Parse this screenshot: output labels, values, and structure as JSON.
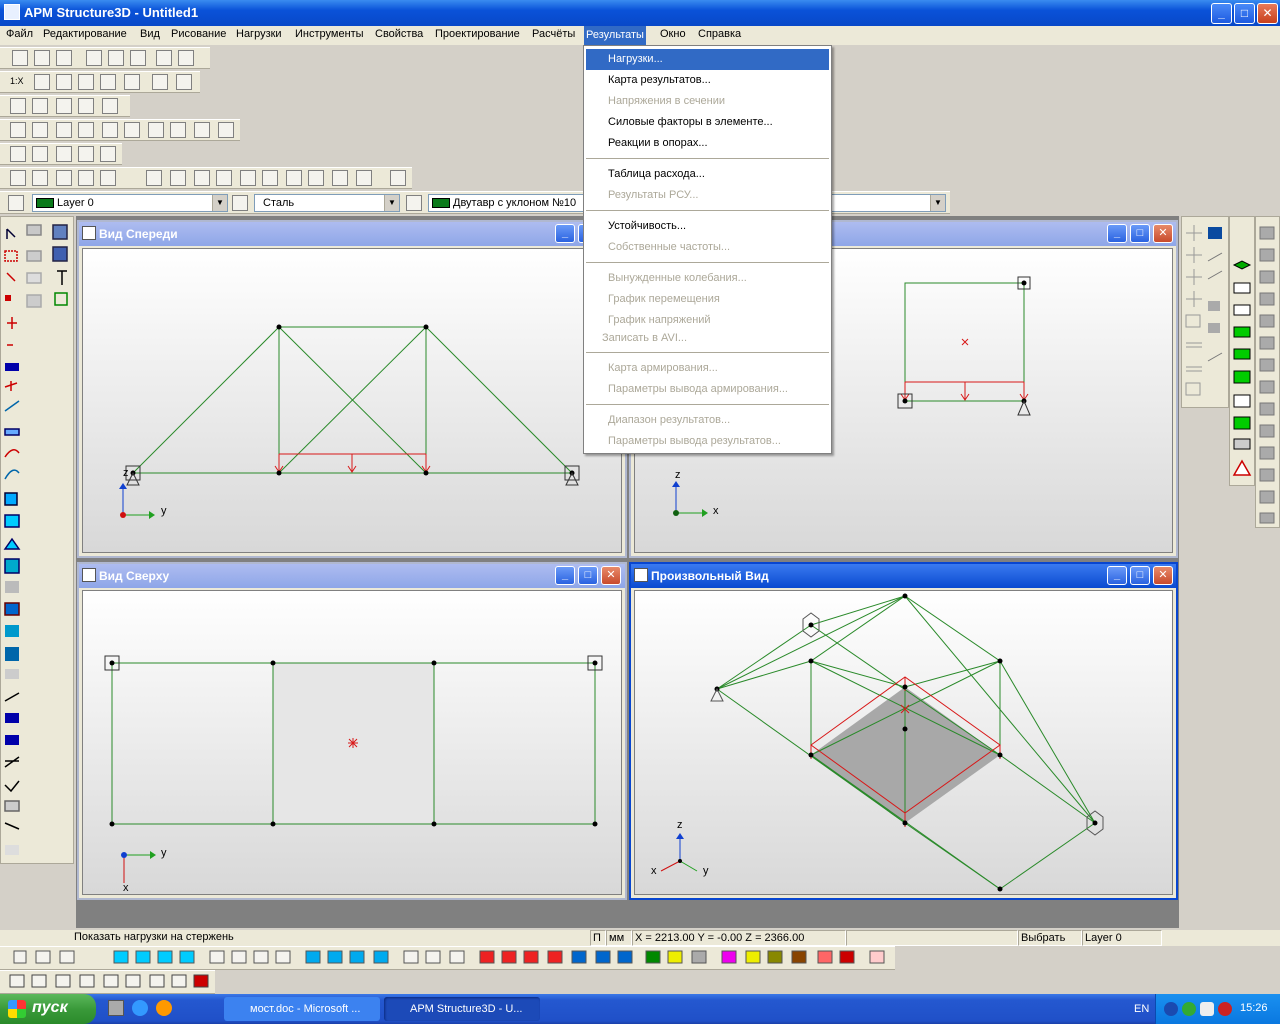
{
  "window": {
    "title": "APM Structure3D - Untitled1",
    "min": "_",
    "max": "□",
    "close": "✕"
  },
  "menubar": [
    "Файл",
    "Редактирование",
    "Вид",
    "Рисование",
    "Нагрузки",
    "Инструменты",
    "Свойства",
    "Проектирование",
    "Расчёты",
    "Результаты",
    "Окно",
    "Справка"
  ],
  "dropdown": {
    "items": [
      {
        "label": "Нагрузки...",
        "state": "selected"
      },
      {
        "label": "Карта результатов...",
        "state": "enabled"
      },
      {
        "label": "Напряжения в сечении",
        "state": "disabled"
      },
      {
        "label": "Силовые факторы в элементе...",
        "state": "enabled"
      },
      {
        "label": "Реакции в опорах...",
        "state": "enabled"
      },
      {
        "label": "Таблица расхода...",
        "state": "enabled"
      },
      {
        "label": "Результаты РСУ...",
        "state": "disabled"
      },
      {
        "label": "Устойчивость...",
        "state": "enabled"
      },
      {
        "label": "Собственные частоты...",
        "state": "disabled"
      },
      {
        "label": "Вынужденные колебания...",
        "state": "disabled"
      },
      {
        "label": "График перемещения",
        "state": "disabled"
      },
      {
        "label": "График напряжений",
        "state": "disabled"
      },
      {
        "label": "Записать в AVI...",
        "state": "disabled"
      },
      {
        "label": "Карта армирования...",
        "state": "disabled"
      },
      {
        "label": "Параметры вывода армирования...",
        "state": "disabled"
      },
      {
        "label": "Диапазон результатов...",
        "state": "disabled"
      },
      {
        "label": "Параметры вывода результатов...",
        "state": "disabled"
      }
    ]
  },
  "combos": {
    "layer": "Layer 0",
    "material": "Сталь",
    "section": "Двутавр с уклоном  №10"
  },
  "toolbar_text": {
    "scale": "1:X"
  },
  "views": {
    "front": {
      "title": "Вид Спереди",
      "axis_v": "z",
      "axis_h": "y"
    },
    "side": {
      "axis_v": "z",
      "axis_h": "x"
    },
    "top": {
      "title": "Вид Сверху",
      "axis_v": "x",
      "axis_h": "y"
    },
    "iso": {
      "title": "Произвольный Вид",
      "axis_v": "z",
      "axis_x": "x",
      "axis_y": "y"
    }
  },
  "status": {
    "hint": "Показать нагрузки на стержень",
    "p": "П",
    "units": "мм",
    "coords": "X = 2213.00 Y = -0.00 Z = 2366.00",
    "mode": "Выбрать",
    "layer": "Layer 0"
  },
  "taskbar": {
    "start": "пуск",
    "tasks": [
      {
        "label": "мост.doc - Microsoft ...",
        "active": false
      },
      {
        "label": "APM Structure3D - U...",
        "active": true
      }
    ],
    "lang": "EN",
    "clock": "15:26"
  },
  "colors": {
    "title_blue": "#0a52d8",
    "menu_highlight": "#316ac5",
    "structure_green": "#2a8a2a",
    "load_red": "#d81818"
  }
}
